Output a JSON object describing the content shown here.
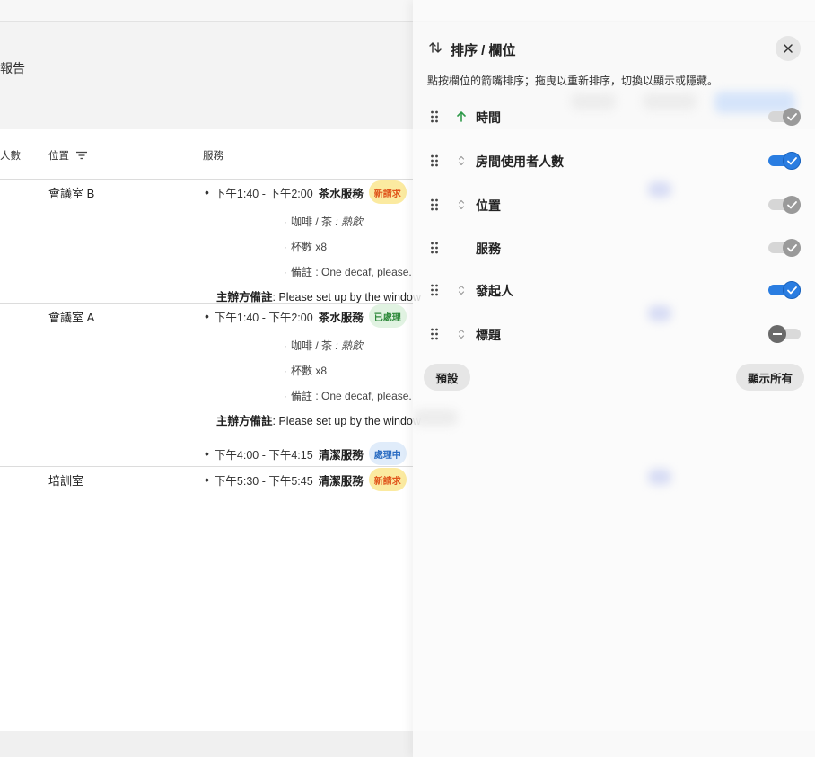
{
  "page": {
    "report_title": "報告"
  },
  "table": {
    "headers": {
      "count": "人數",
      "location": "位置",
      "service": "服務"
    },
    "rows": [
      {
        "room": "會議室 B",
        "services": [
          {
            "time": "下午1:40 - 下午2:00",
            "name": "茶水服務",
            "badge": "新請求",
            "details": [
              {
                "label": "咖啡 / 茶",
                "value": ": 熱飲"
              },
              {
                "label": "杯數 x8"
              },
              {
                "label": "備註",
                "value": ": One decaf, please."
              }
            ],
            "organizer": {
              "label": "主辦方備註",
              "value": ": Please set up by the window"
            }
          }
        ]
      },
      {
        "room": "會議室 A",
        "services": [
          {
            "time": "下午1:40 - 下午2:00",
            "name": "茶水服務",
            "badge": "已處理",
            "details": [
              {
                "label": "咖啡 / 茶",
                "value": ": 熱飲"
              },
              {
                "label": "杯數 x8"
              },
              {
                "label": "備註",
                "value": ": One decaf, please."
              }
            ],
            "organizer": {
              "label": "主辦方備註",
              "value": ": Please set up by the window"
            }
          },
          {
            "time": "下午4:00 - 下午4:15",
            "name": "清潔服務",
            "badge": "處理中"
          }
        ]
      },
      {
        "room": "培訓室",
        "services": [
          {
            "time": "下午5:30 - 下午5:45",
            "name": "清潔服務",
            "badge": "新請求"
          }
        ]
      }
    ]
  },
  "panel": {
    "title": "排序 / 欄位",
    "description": "點按欄位的箭嘴排序；拖曳以重新排序，切換以顯示或隱藏。",
    "fields": [
      {
        "label": "時間",
        "sort": "ascending",
        "visibility": "locked-on"
      },
      {
        "label": "房間使用者人數",
        "sort": "sortable",
        "visibility": "on"
      },
      {
        "label": "位置",
        "sort": "sortable",
        "visibility": "locked-on"
      },
      {
        "label": "服務",
        "sort": "none",
        "visibility": "locked-on"
      },
      {
        "label": "發起人",
        "sort": "sortable",
        "visibility": "on"
      },
      {
        "label": "標題",
        "sort": "sortable",
        "visibility": "off"
      }
    ],
    "default_button": "預設",
    "show_all_button": "顯示所有"
  },
  "colors": {
    "toggle_on": "#2a7de1",
    "sort_active": "#2f9a4a",
    "badge_new_bg": "#fbeaa0",
    "badge_new_text": "#e0561c",
    "badge_done_bg": "#e1f3e2",
    "badge_done_text": "#2f8a3c",
    "badge_progress_bg": "#e0ecfa",
    "badge_progress_text": "#2a6cc2"
  }
}
